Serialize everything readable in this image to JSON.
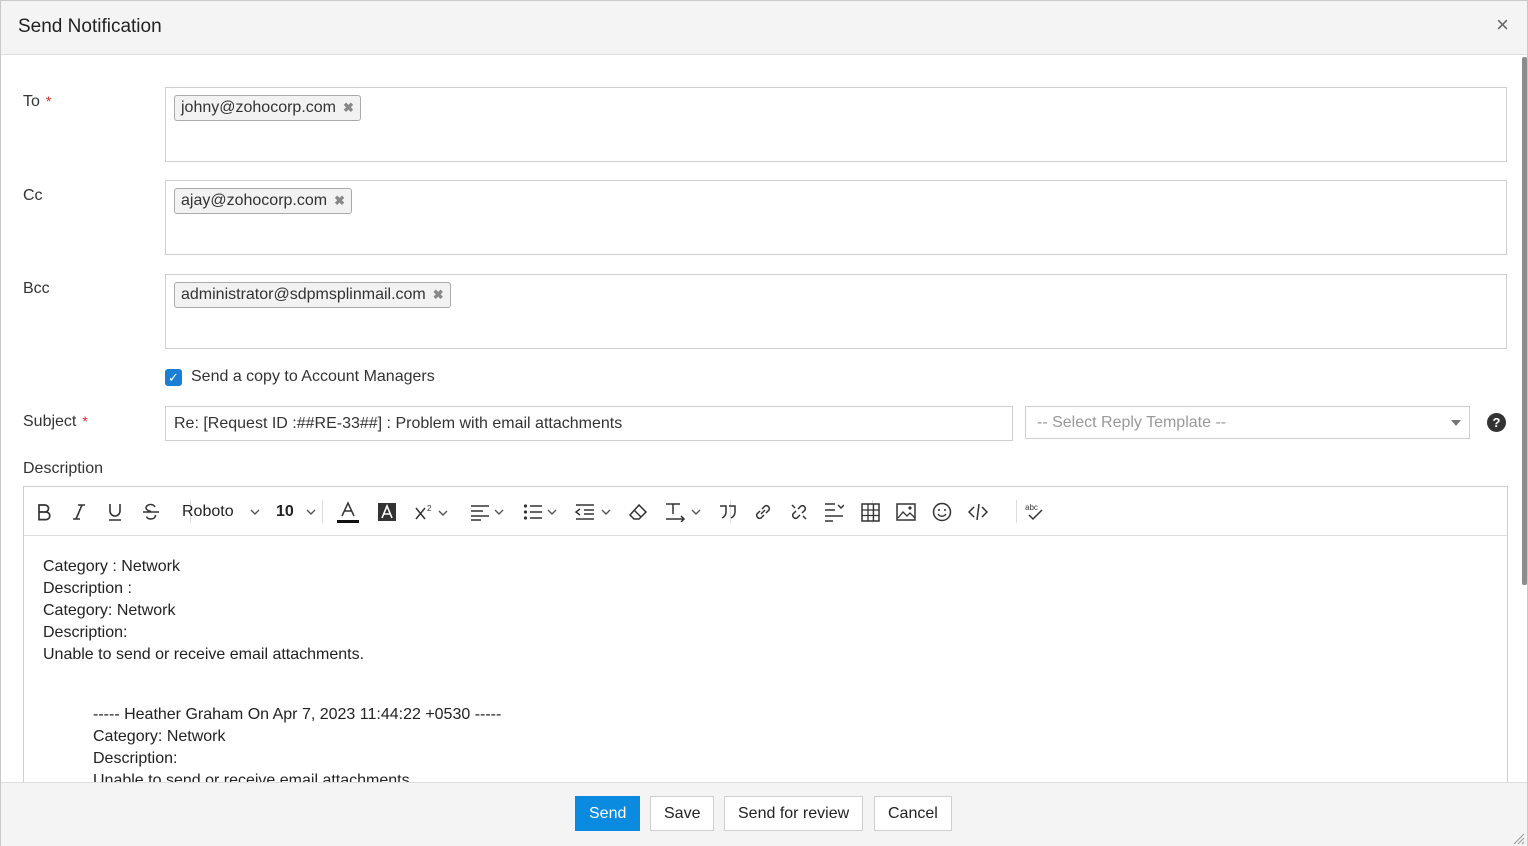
{
  "dialog": {
    "title": "Send Notification",
    "close_glyph": "×"
  },
  "to": {
    "label": "To",
    "required": "*",
    "chips": [
      "johny@zohocorp.com"
    ]
  },
  "cc": {
    "label": "Cc",
    "chips": [
      "ajay@zohocorp.com"
    ]
  },
  "bcc": {
    "label": "Bcc",
    "chips": [
      "administrator@sdpmsplinmail.com"
    ]
  },
  "chip_remove_glyph": "✖",
  "account_managers": {
    "label": "Send a copy to Account Managers",
    "checked": true,
    "check_glyph": "✓"
  },
  "subject": {
    "label": "Subject",
    "required": "*",
    "value": "Re: [Request ID :##RE-33##] : Problem with email attachments"
  },
  "reply_template": {
    "placeholder": "-- Select Reply Template --"
  },
  "help": {
    "glyph": "?"
  },
  "description": {
    "label": "Description",
    "toolbar": {
      "font_family": "Roboto",
      "font_size": "10",
      "icons": [
        "bold-icon",
        "italic-icon",
        "underline-icon",
        "strikethrough-icon",
        "font-color-icon",
        "highlight-icon",
        "superscript-icon",
        "align-icon",
        "list-icon",
        "indent-icon",
        "clear-format-icon",
        "text-direction-icon",
        "quote-icon",
        "link-icon",
        "unlink-icon",
        "line-spacing-icon",
        "table-icon",
        "image-icon",
        "emoji-icon",
        "code-icon",
        "spellcheck-icon"
      ]
    },
    "body_lines": [
      "Category : Network",
      "Description :",
      "Category: Network",
      "Description:",
      "Unable to send or receive email attachments."
    ],
    "quoted_lines": [
      "----- Heather Graham On Apr 7, 2023 11:44:22 +0530 -----",
      "Category: Network",
      "Description:",
      "Unable to send or receive email attachments."
    ]
  },
  "footer": {
    "send": "Send",
    "save": "Save",
    "send_for_review": "Send for review",
    "cancel": "Cancel"
  },
  "colors": {
    "primary": "#0b8be0",
    "required": "#e02424",
    "checkbox": "#1a7fd4"
  }
}
